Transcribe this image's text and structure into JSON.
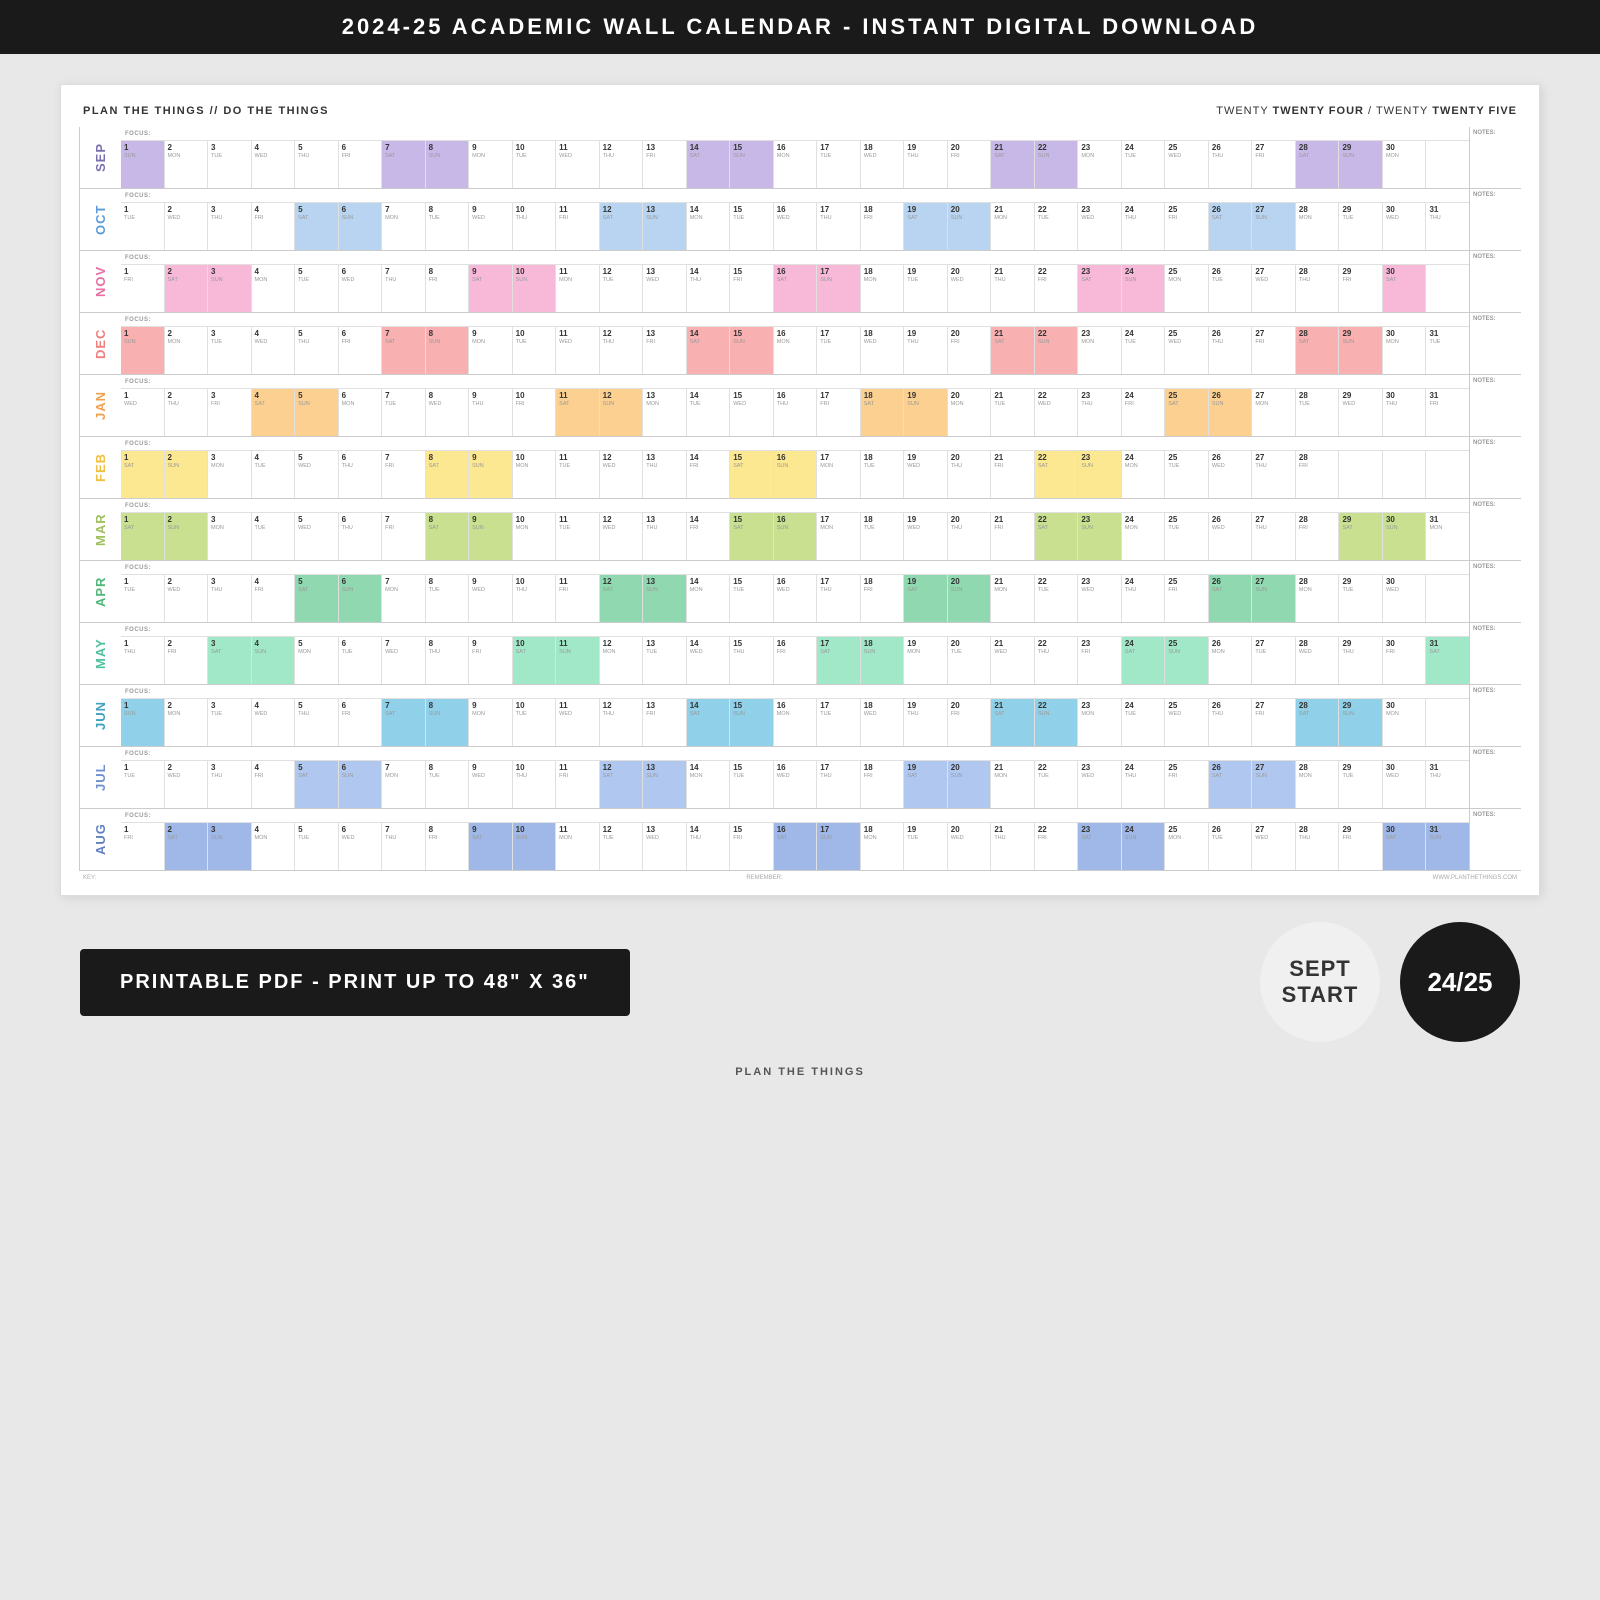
{
  "header": {
    "title": "2024-25 ACADEMIC  WALL CALENDAR - INSTANT DIGITAL DOWNLOAD"
  },
  "calendar": {
    "brand_left": "PLAN THE THINGS // DO THE THINGS",
    "brand_right_pre": "TWENTY ",
    "brand_right_bold1": "TWENTY FOUR",
    "brand_right_mid": " / TWENTY ",
    "brand_right_bold2": "TWENTY FIVE",
    "months": [
      {
        "label": "SEP",
        "color": "sep-color",
        "hlClass": "hl-sep",
        "days": 30,
        "startDay": 0,
        "focusText": ""
      },
      {
        "label": "OCT",
        "color": "oct-color",
        "hlClass": "hl-oct",
        "days": 31,
        "startDay": 2,
        "focusText": ""
      },
      {
        "label": "NOV",
        "color": "nov-color",
        "hlClass": "hl-nov",
        "days": 30,
        "startDay": 5,
        "focusText": ""
      },
      {
        "label": "DEC",
        "color": "dec-color",
        "hlClass": "hl-dec",
        "days": 31,
        "startDay": 0,
        "focusText": ""
      },
      {
        "label": "JAN",
        "color": "jan-color",
        "hlClass": "hl-jan",
        "days": 31,
        "startDay": 3,
        "focusText": ""
      },
      {
        "label": "FEB",
        "color": "feb-color",
        "hlClass": "hl-feb",
        "days": 28,
        "startDay": 6,
        "focusText": ""
      },
      {
        "label": "MAR",
        "color": "mar-color",
        "hlClass": "hl-mar",
        "days": 31,
        "startDay": 6,
        "focusText": ""
      },
      {
        "label": "APR",
        "color": "apr-color",
        "hlClass": "hl-apr",
        "days": 30,
        "startDay": 2,
        "focusText": ""
      },
      {
        "label": "MAY",
        "color": "may-color",
        "hlClass": "hl-may",
        "days": 31,
        "startDay": 4,
        "focusText": ""
      },
      {
        "label": "JUN",
        "color": "jun-color",
        "hlClass": "hl-jun",
        "days": 30,
        "startDay": 0,
        "focusText": ""
      },
      {
        "label": "JUL",
        "color": "jul-color",
        "hlClass": "hl-jul",
        "days": 31,
        "startDay": 2,
        "focusText": ""
      },
      {
        "label": "AUG",
        "color": "aug-color",
        "hlClass": "hl-aug",
        "days": 31,
        "startDay": 5,
        "focusText": ""
      }
    ],
    "dayNames": [
      "SUN",
      "MON",
      "TUE",
      "WED",
      "THU",
      "FRI",
      "SAT"
    ],
    "notes_label": "NOTES",
    "key_label": "KEY:",
    "remember_label": "REMEMBER:",
    "website": "WWW.PLANTHETHINGS.COM"
  },
  "bottom": {
    "print_label": "PRINTABLE PDF - PRINT UP TO 48\" x 36\"",
    "sept_line1": "SEPT",
    "sept_line2": "START",
    "year_label": "24/25"
  },
  "footer": {
    "brand": "PLAN THE THINGS"
  }
}
